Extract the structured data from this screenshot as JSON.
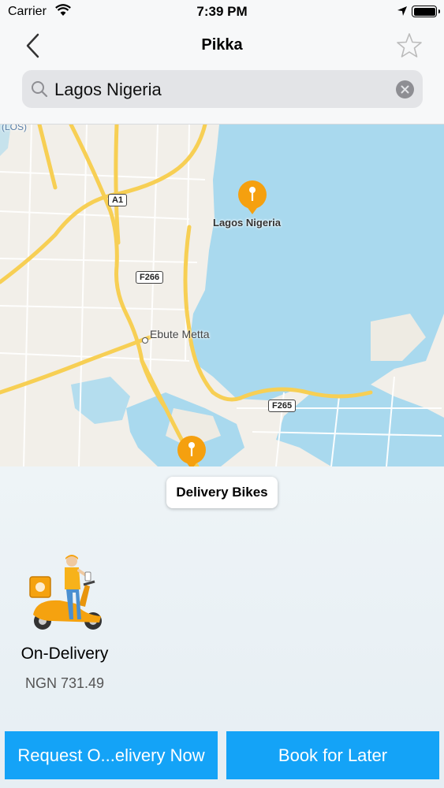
{
  "status_bar": {
    "carrier": "Carrier",
    "time": "7:39 PM"
  },
  "nav": {
    "title": "Pikka",
    "back_icon": "chevron-left-icon",
    "star_icon": "star-icon"
  },
  "search": {
    "value": "Lagos Nigeria",
    "icon": "search-icon",
    "clear_icon": "clear-icon"
  },
  "map": {
    "labels": {
      "los": "(LOS)",
      "pin_label": "Lagos Nigeria",
      "district": "Ebute Metta"
    },
    "road_shields": {
      "a1": "A1",
      "f266": "F266",
      "f265": "F265"
    },
    "colors": {
      "water": "#a9d9ee",
      "land": "#f2efe9",
      "road": "#f7cf54",
      "pin": "#f5a00f"
    }
  },
  "category_chip": "Delivery Bikes",
  "vehicle": {
    "name": "On-Delivery",
    "price": "NGN 731.49"
  },
  "buttons": {
    "request": "Request O...elivery Now",
    "later": "Book for Later"
  },
  "colors": {
    "accent": "#14a3f7"
  }
}
